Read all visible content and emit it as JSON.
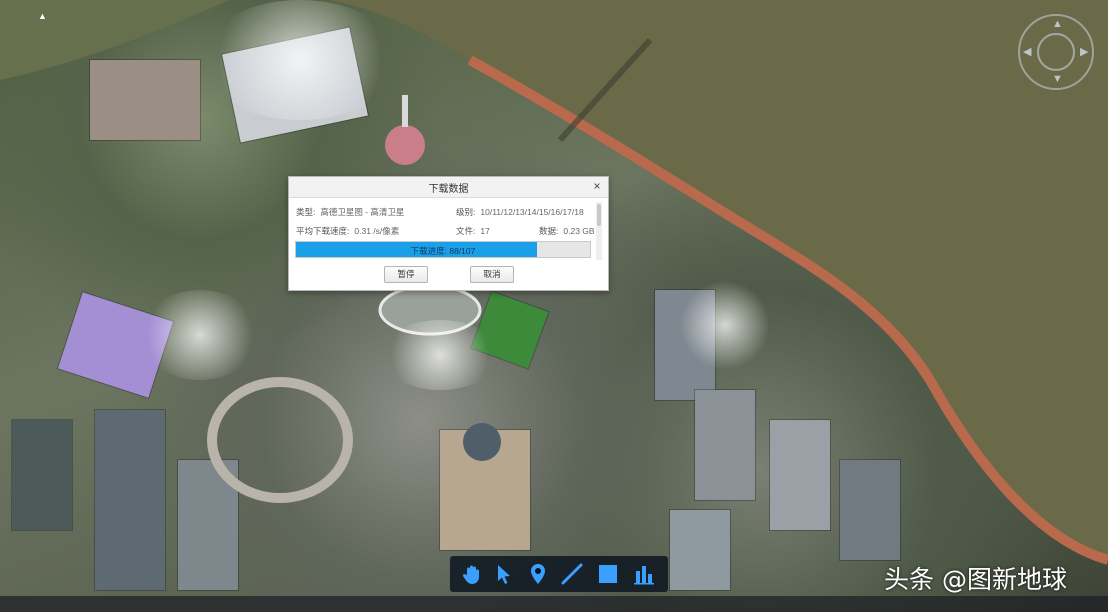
{
  "dialog": {
    "title": "下载数据",
    "close_glyph": "×",
    "fields": {
      "type_label": "类型:",
      "type_value": "高德卫星图 - 高清卫星",
      "level_label": "级别:",
      "level_value": "10/11/12/13/14/15/16/17/18",
      "speed_label": "平均下载速度:",
      "speed_value": "0.31 /s/像素",
      "files_label": "文件:",
      "files_value": "17",
      "size_label": "数据:",
      "size_value": "0.23 GB"
    },
    "progress": {
      "text": "下载进度: 88/107",
      "fraction": 0.82
    },
    "buttons": {
      "pause": "暂停",
      "cancel": "取消"
    }
  },
  "toolbar": {
    "tools": [
      {
        "icon": "hand-pan-icon",
        "label": "pan"
      },
      {
        "icon": "cursor-arrow-icon",
        "label": "select"
      },
      {
        "icon": "map-pin-icon",
        "label": "placemark"
      },
      {
        "icon": "line-draw-icon",
        "label": "line"
      },
      {
        "icon": "polygon-square-icon",
        "label": "polygon"
      },
      {
        "icon": "bar-chart-icon",
        "label": "chart"
      }
    ]
  },
  "watermark": "头条 @图新地球",
  "colors": {
    "progress_fill": "#1aa0e8",
    "toolbar_bg": "#0a121e",
    "icon_blue": "#3aa0ff"
  }
}
